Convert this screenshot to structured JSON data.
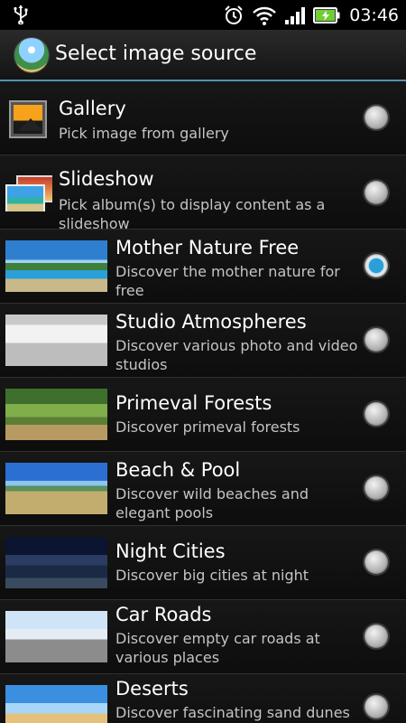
{
  "status_bar": {
    "time": "03:46",
    "icons": [
      "usb-icon",
      "alarm-icon",
      "wifi-icon",
      "signal-icon",
      "battery-charging-icon"
    ]
  },
  "header": {
    "title": "Select image source",
    "icon": "app-globe-icon"
  },
  "colors": {
    "accent": "#4f93b3",
    "radio_selected": "#2d9fd8",
    "description_text": "#c4c4c4"
  },
  "sources": [
    {
      "title": "Gallery",
      "description": "Pick image from gallery",
      "selected": false
    },
    {
      "title": "Slideshow",
      "description": "Pick album(s) to display content as a slideshow",
      "selected": false
    },
    {
      "title": "Mother Nature Free",
      "description": "Discover the mother nature for free",
      "selected": true
    },
    {
      "title": "Studio Atmospheres",
      "description": "Discover various photo and video studios",
      "selected": false
    },
    {
      "title": "Primeval Forests",
      "description": "Discover primeval forests",
      "selected": false
    },
    {
      "title": "Beach & Pool",
      "description": "Discover wild beaches and elegant pools",
      "selected": false
    },
    {
      "title": "Night Cities",
      "description": "Discover big cities at night",
      "selected": false
    },
    {
      "title": "Car Roads",
      "description": "Discover empty car roads at various places",
      "selected": false
    },
    {
      "title": "Deserts",
      "description": "Discover fascinating sand dunes",
      "selected": false
    }
  ]
}
